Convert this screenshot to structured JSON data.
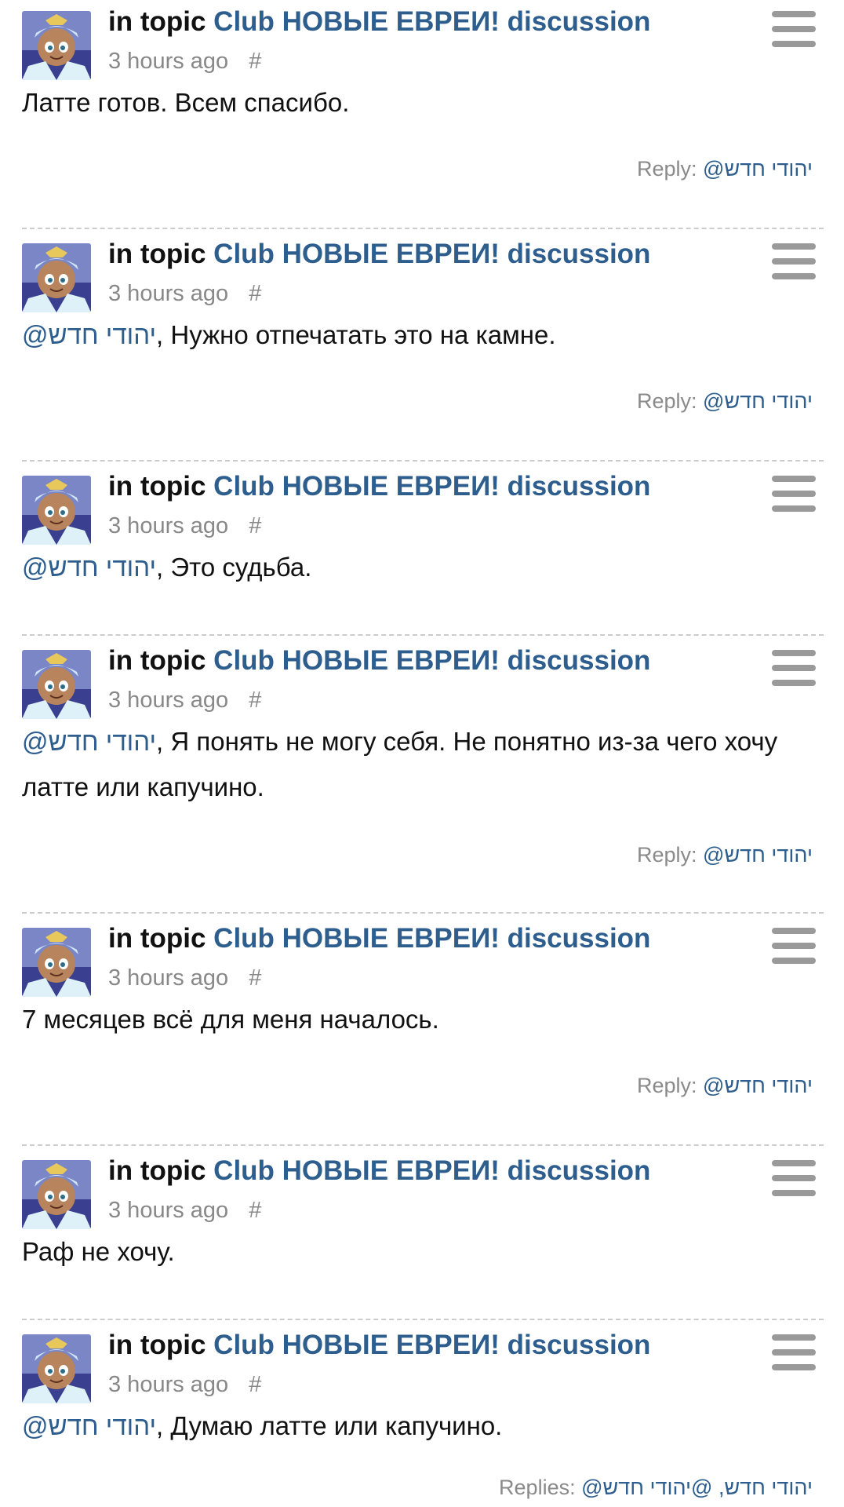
{
  "feed": {
    "in_topic_label": "in topic",
    "topic_title": "Club НОВЫЕ ЕВРЕИ! discussion",
    "timestamp": "3 hours ago",
    "permalink": "#",
    "mention_name": "@יהודי חדש",
    "reply_label": "Reply:",
    "replies_label": "Replies:",
    "avatar_icon": "avatar-cartoon-character-icon",
    "menu_icon": "hamburger-menu-icon",
    "colors": {
      "link": "#2e5e8e",
      "muted": "#888888",
      "menu": "#9a9a9a"
    },
    "posts": [
      {
        "mention": "",
        "text": "Латте готов. Всем спасибо.",
        "reply": "@יהודי חדש"
      },
      {
        "mention": "@יהודי חדש",
        "text": ", Нужно отпечатать это на камне.",
        "reply": "@יהודי חדש"
      },
      {
        "mention": "@יהודי חדש",
        "text": ", Это судьба.",
        "reply": ""
      },
      {
        "mention": "@יהודי חדש",
        "text": ", Я понять не могу себя. Не понятно из-за чего хочу латте или капучино.",
        "reply": "@יהודי חדש"
      },
      {
        "mention": "",
        "text": "7 месяцев всё для меня началось.",
        "reply": "@יהודי חדש"
      },
      {
        "mention": "",
        "text": "Раф не хочу.",
        "reply": ""
      },
      {
        "mention": "@יהודי חדש",
        "text": ", Думаю латте или капучино.",
        "replies": "@יהודי חדש, @יהודי חדש"
      }
    ]
  }
}
